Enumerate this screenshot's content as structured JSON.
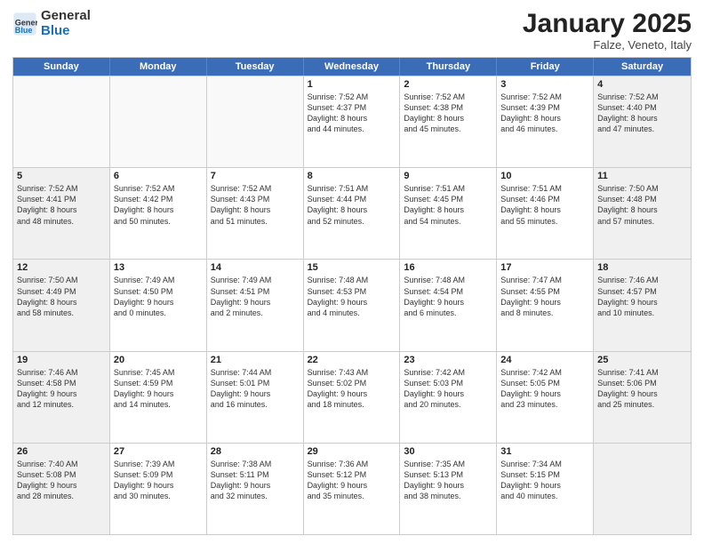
{
  "logo": {
    "general": "General",
    "blue": "Blue"
  },
  "header": {
    "month": "January 2025",
    "location": "Falze, Veneto, Italy"
  },
  "weekdays": [
    "Sunday",
    "Monday",
    "Tuesday",
    "Wednesday",
    "Thursday",
    "Friday",
    "Saturday"
  ],
  "rows": [
    [
      {
        "day": "",
        "info": "",
        "empty": true
      },
      {
        "day": "",
        "info": "",
        "empty": true
      },
      {
        "day": "",
        "info": "",
        "empty": true
      },
      {
        "day": "1",
        "info": "Sunrise: 7:52 AM\nSunset: 4:37 PM\nDaylight: 8 hours\nand 44 minutes.",
        "empty": false
      },
      {
        "day": "2",
        "info": "Sunrise: 7:52 AM\nSunset: 4:38 PM\nDaylight: 8 hours\nand 45 minutes.",
        "empty": false
      },
      {
        "day": "3",
        "info": "Sunrise: 7:52 AM\nSunset: 4:39 PM\nDaylight: 8 hours\nand 46 minutes.",
        "empty": false
      },
      {
        "day": "4",
        "info": "Sunrise: 7:52 AM\nSunset: 4:40 PM\nDaylight: 8 hours\nand 47 minutes.",
        "empty": false,
        "shaded": true
      }
    ],
    [
      {
        "day": "5",
        "info": "Sunrise: 7:52 AM\nSunset: 4:41 PM\nDaylight: 8 hours\nand 48 minutes.",
        "empty": false,
        "shaded": true
      },
      {
        "day": "6",
        "info": "Sunrise: 7:52 AM\nSunset: 4:42 PM\nDaylight: 8 hours\nand 50 minutes.",
        "empty": false
      },
      {
        "day": "7",
        "info": "Sunrise: 7:52 AM\nSunset: 4:43 PM\nDaylight: 8 hours\nand 51 minutes.",
        "empty": false
      },
      {
        "day": "8",
        "info": "Sunrise: 7:51 AM\nSunset: 4:44 PM\nDaylight: 8 hours\nand 52 minutes.",
        "empty": false
      },
      {
        "day": "9",
        "info": "Sunrise: 7:51 AM\nSunset: 4:45 PM\nDaylight: 8 hours\nand 54 minutes.",
        "empty": false
      },
      {
        "day": "10",
        "info": "Sunrise: 7:51 AM\nSunset: 4:46 PM\nDaylight: 8 hours\nand 55 minutes.",
        "empty": false
      },
      {
        "day": "11",
        "info": "Sunrise: 7:50 AM\nSunset: 4:48 PM\nDaylight: 8 hours\nand 57 minutes.",
        "empty": false,
        "shaded": true
      }
    ],
    [
      {
        "day": "12",
        "info": "Sunrise: 7:50 AM\nSunset: 4:49 PM\nDaylight: 8 hours\nand 58 minutes.",
        "empty": false,
        "shaded": true
      },
      {
        "day": "13",
        "info": "Sunrise: 7:49 AM\nSunset: 4:50 PM\nDaylight: 9 hours\nand 0 minutes.",
        "empty": false
      },
      {
        "day": "14",
        "info": "Sunrise: 7:49 AM\nSunset: 4:51 PM\nDaylight: 9 hours\nand 2 minutes.",
        "empty": false
      },
      {
        "day": "15",
        "info": "Sunrise: 7:48 AM\nSunset: 4:53 PM\nDaylight: 9 hours\nand 4 minutes.",
        "empty": false
      },
      {
        "day": "16",
        "info": "Sunrise: 7:48 AM\nSunset: 4:54 PM\nDaylight: 9 hours\nand 6 minutes.",
        "empty": false
      },
      {
        "day": "17",
        "info": "Sunrise: 7:47 AM\nSunset: 4:55 PM\nDaylight: 9 hours\nand 8 minutes.",
        "empty": false
      },
      {
        "day": "18",
        "info": "Sunrise: 7:46 AM\nSunset: 4:57 PM\nDaylight: 9 hours\nand 10 minutes.",
        "empty": false,
        "shaded": true
      }
    ],
    [
      {
        "day": "19",
        "info": "Sunrise: 7:46 AM\nSunset: 4:58 PM\nDaylight: 9 hours\nand 12 minutes.",
        "empty": false,
        "shaded": true
      },
      {
        "day": "20",
        "info": "Sunrise: 7:45 AM\nSunset: 4:59 PM\nDaylight: 9 hours\nand 14 minutes.",
        "empty": false
      },
      {
        "day": "21",
        "info": "Sunrise: 7:44 AM\nSunset: 5:01 PM\nDaylight: 9 hours\nand 16 minutes.",
        "empty": false
      },
      {
        "day": "22",
        "info": "Sunrise: 7:43 AM\nSunset: 5:02 PM\nDaylight: 9 hours\nand 18 minutes.",
        "empty": false
      },
      {
        "day": "23",
        "info": "Sunrise: 7:42 AM\nSunset: 5:03 PM\nDaylight: 9 hours\nand 20 minutes.",
        "empty": false
      },
      {
        "day": "24",
        "info": "Sunrise: 7:42 AM\nSunset: 5:05 PM\nDaylight: 9 hours\nand 23 minutes.",
        "empty": false
      },
      {
        "day": "25",
        "info": "Sunrise: 7:41 AM\nSunset: 5:06 PM\nDaylight: 9 hours\nand 25 minutes.",
        "empty": false,
        "shaded": true
      }
    ],
    [
      {
        "day": "26",
        "info": "Sunrise: 7:40 AM\nSunset: 5:08 PM\nDaylight: 9 hours\nand 28 minutes.",
        "empty": false,
        "shaded": true
      },
      {
        "day": "27",
        "info": "Sunrise: 7:39 AM\nSunset: 5:09 PM\nDaylight: 9 hours\nand 30 minutes.",
        "empty": false
      },
      {
        "day": "28",
        "info": "Sunrise: 7:38 AM\nSunset: 5:11 PM\nDaylight: 9 hours\nand 32 minutes.",
        "empty": false
      },
      {
        "day": "29",
        "info": "Sunrise: 7:36 AM\nSunset: 5:12 PM\nDaylight: 9 hours\nand 35 minutes.",
        "empty": false
      },
      {
        "day": "30",
        "info": "Sunrise: 7:35 AM\nSunset: 5:13 PM\nDaylight: 9 hours\nand 38 minutes.",
        "empty": false
      },
      {
        "day": "31",
        "info": "Sunrise: 7:34 AM\nSunset: 5:15 PM\nDaylight: 9 hours\nand 40 minutes.",
        "empty": false
      },
      {
        "day": "",
        "info": "",
        "empty": true,
        "shaded": true
      }
    ]
  ]
}
